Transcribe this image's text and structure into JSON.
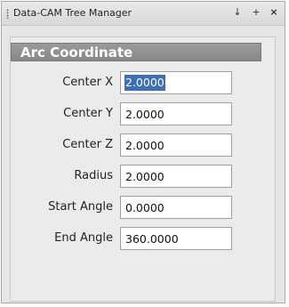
{
  "window": {
    "title": "Data-CAM Tree Manager",
    "pin_glyph": "↓",
    "float_glyph": "+",
    "close_glyph": "×"
  },
  "section": {
    "title": "Arc Coordinate"
  },
  "fields": [
    {
      "label": "Center X",
      "value": "2.0000"
    },
    {
      "label": "Center Y",
      "value": "2.0000"
    },
    {
      "label": "Center Z",
      "value": "2.0000"
    },
    {
      "label": "Radius",
      "value": "2.0000"
    },
    {
      "label": "Start Angle",
      "value": "0.0000"
    },
    {
      "label": "End Angle",
      "value": "360.0000"
    }
  ],
  "colors": {
    "header_bg": "#8f8f8f",
    "selection": "#3d6fb8"
  }
}
